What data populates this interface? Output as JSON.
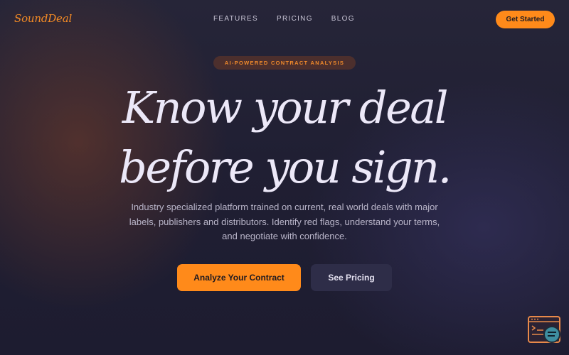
{
  "brand": {
    "logo_text": "SoundDeal",
    "accent_color": "#ff8a1a"
  },
  "nav": {
    "links": [
      "FEATURES",
      "PRICING",
      "BLOG"
    ],
    "cta_label": "Get Started"
  },
  "hero": {
    "badge": "AI-POWERED CONTRACT ANALYSIS",
    "headline_line1": "Know your deal",
    "headline_line2": "before you sign.",
    "subtitle": "Industry specialized platform trained on current, real world deals with major labels, publishers and distributors. Identify red flags, understand your terms, and negotiate with confidence.",
    "primary_cta": "Analyze Your Contract",
    "secondary_cta": "See Pricing"
  },
  "widget": {
    "icon": "chat-widget-icon"
  }
}
